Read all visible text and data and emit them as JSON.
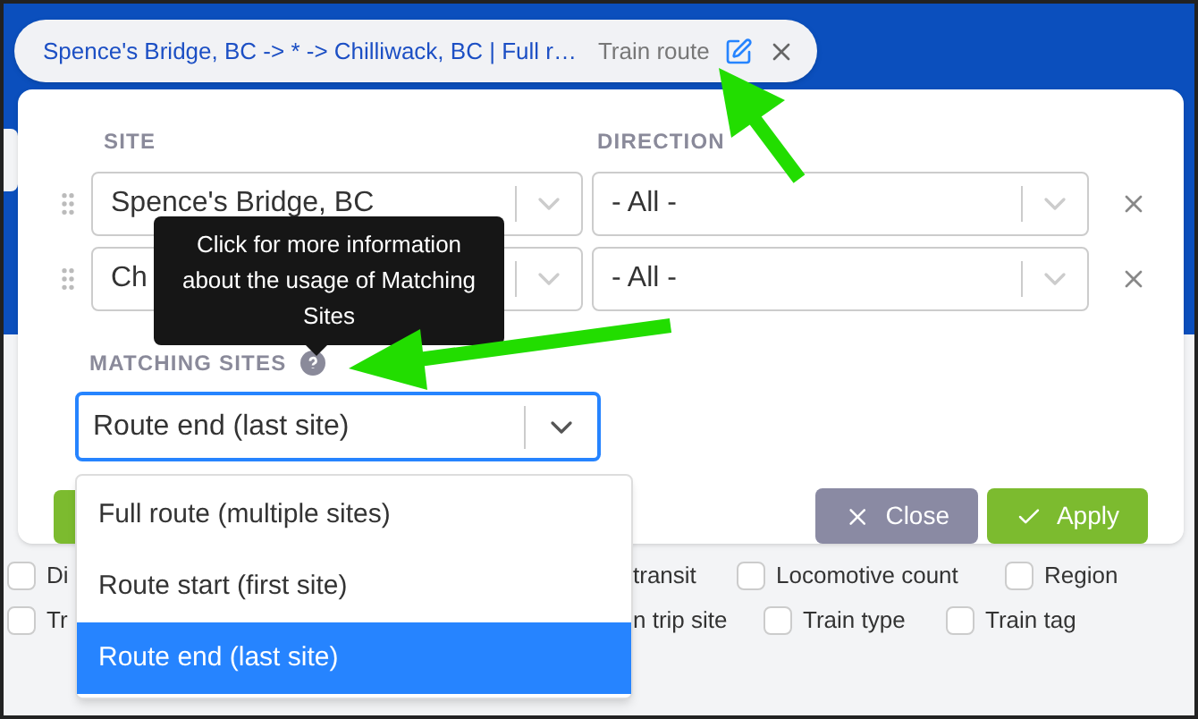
{
  "filter_chip": {
    "label": "Spence's Bridge, BC -> * -> Chilliwack, BC | Full r…",
    "type": "Train route"
  },
  "sites_table": {
    "columns": [
      "SITE",
      "DIRECTION"
    ],
    "rows": [
      {
        "site": "Spence's Bridge, BC",
        "direction": "- All -"
      },
      {
        "site": "Ch",
        "direction": "- All -"
      }
    ]
  },
  "tooltip": {
    "text": "Click for more information about the usage of Matching Sites"
  },
  "matching_sites": {
    "label": "MATCHING SITES",
    "value": "Route end (last site)",
    "options": [
      {
        "label": "Full route (multiple sites)",
        "selected": false
      },
      {
        "label": "Route start (first site)",
        "selected": false
      },
      {
        "label": "Route end (last site)",
        "selected": true
      }
    ]
  },
  "buttons": [
    {
      "label": "Close",
      "kind": "close"
    },
    {
      "label": "Apply",
      "kind": "apply"
    }
  ],
  "background_filters": [
    {
      "label": "Di",
      "checked": false
    },
    {
      "label": "transit"
    },
    {
      "label": "Locomotive count",
      "checked": false
    },
    {
      "label": "Region",
      "checked": false
    },
    {
      "label": "Tr",
      "checked": false
    },
    {
      "label": "n trip site"
    },
    {
      "label": "Train type",
      "checked": false
    },
    {
      "label": "Train tag",
      "checked": false
    }
  ]
}
